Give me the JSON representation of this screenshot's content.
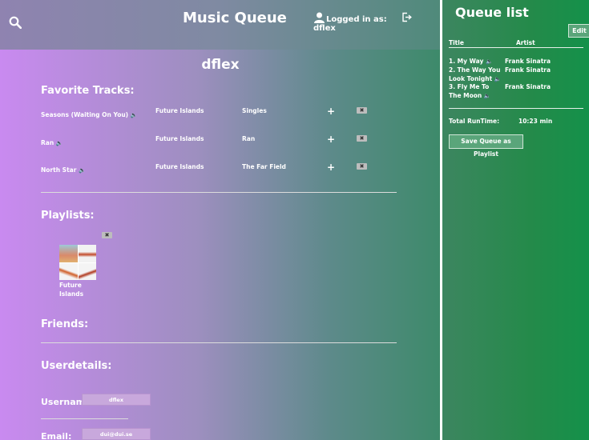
{
  "header": {
    "app_title": "Music Queue",
    "logged_in_label": "Logged in as:",
    "username": "dflex"
  },
  "profile": {
    "name": "dflex"
  },
  "favorites": {
    "title": "Favorite Tracks:",
    "add_symbol": "+",
    "delete_symbol": "✖",
    "tracks": [
      {
        "title": "Seasons (Waiting On You)",
        "artist": "Future Islands",
        "album": "Singles"
      },
      {
        "title": "Ran",
        "artist": "Future Islands",
        "album": "Ran"
      },
      {
        "title": "North Star",
        "artist": "Future Islands",
        "album": "The Far Field"
      }
    ]
  },
  "playlists": {
    "title": "Playlists:",
    "items": [
      {
        "name": "Future Islands"
      }
    ]
  },
  "friends": {
    "title": "Friends:"
  },
  "userdetails": {
    "title": "Userdetails:",
    "username_label": "Username:",
    "username_value": "dflex",
    "email_label": "Email:",
    "email_value": "dui@dui.se"
  },
  "queue": {
    "title": "Queue list",
    "edit_label": "Edit",
    "col_title": "Title",
    "col_artist": "Artist",
    "items": [
      {
        "title": "1. My Way",
        "artist": "Frank Sinatra"
      },
      {
        "title": "2. The Way You Look Tonight",
        "artist": "Frank Sinatra"
      },
      {
        "title": "3. Fly Me To The Moon",
        "artist": "Frank Sinatra"
      }
    ],
    "total_label": "Total RunTime:",
    "total_value": "10:23 min",
    "save_label": "Save Queue as Playlist"
  }
}
